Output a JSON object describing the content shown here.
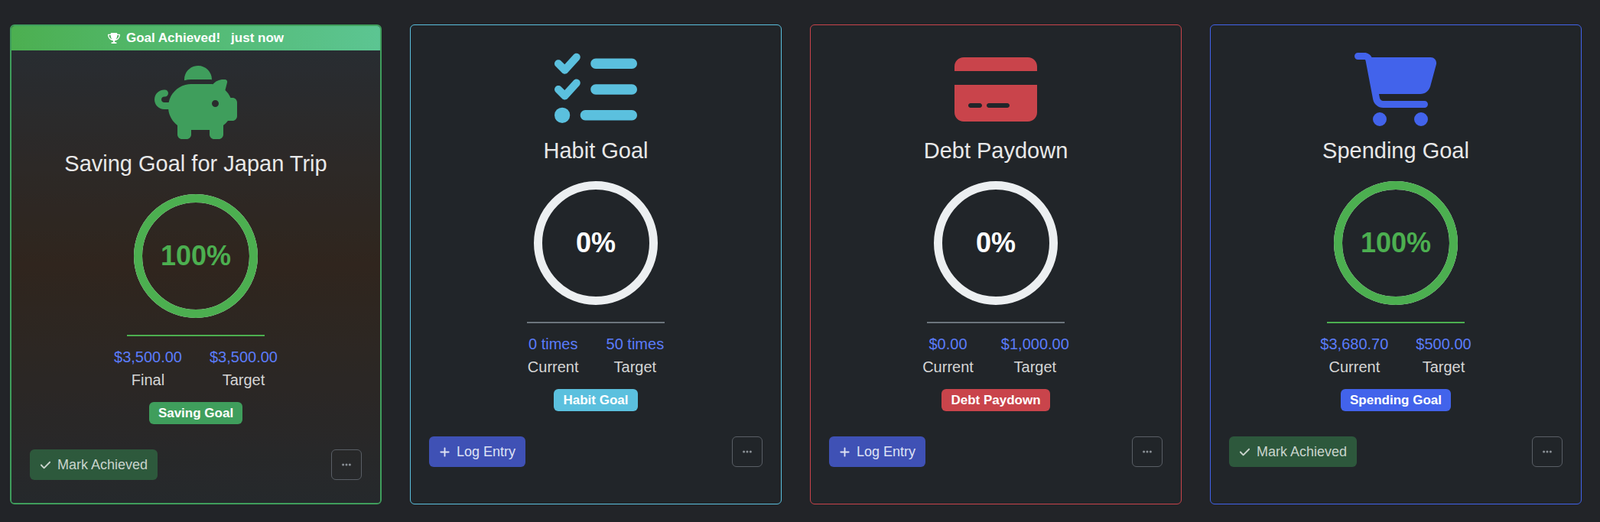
{
  "goals": [
    {
      "kind": "saving",
      "title": "Saving Goal for Japan Trip",
      "color": "#3f9e5c",
      "level": 1,
      "percent": "100%",
      "current": "$3,500.00",
      "current_label": "Final",
      "target": "$3,500.00",
      "target_label": "Target",
      "badge": "Saving Goal",
      "achieved": true,
      "photo": true,
      "banner": {
        "text": "Goal Achieved!",
        "time": "just now"
      },
      "action": {
        "label": "Mark Achieved",
        "kind": "mark"
      }
    },
    {
      "kind": "habit",
      "title": "Habit Goal",
      "color": "#5bc0de",
      "level": 0,
      "percent": "0%",
      "current": "0 times",
      "current_label": "Current",
      "target": "50 times",
      "target_label": "Target",
      "badge": "Habit Goal",
      "achieved": false,
      "photo": false,
      "banner": null,
      "action": {
        "label": "Log Entry",
        "kind": "log"
      }
    },
    {
      "kind": "debt",
      "title": "Debt Paydown",
      "color": "#c9444b",
      "level": 0,
      "percent": "0%",
      "current": "$0.00",
      "current_label": "Current",
      "target": "$1,000.00",
      "target_label": "Target",
      "badge": "Debt Paydown",
      "achieved": false,
      "photo": false,
      "banner": null,
      "action": {
        "label": "Log Entry",
        "kind": "log"
      }
    },
    {
      "kind": "spending",
      "title": "Spending Goal",
      "color": "#4263eb",
      "level": 1,
      "percent": "100%",
      "current": "$3,680.70",
      "current_label": "Current",
      "target": "$500.00",
      "target_label": "Target",
      "badge": "Spending Goal",
      "achieved": false,
      "photo": false,
      "banner": null,
      "action": {
        "label": "Mark Achieved",
        "kind": "mark"
      }
    }
  ]
}
